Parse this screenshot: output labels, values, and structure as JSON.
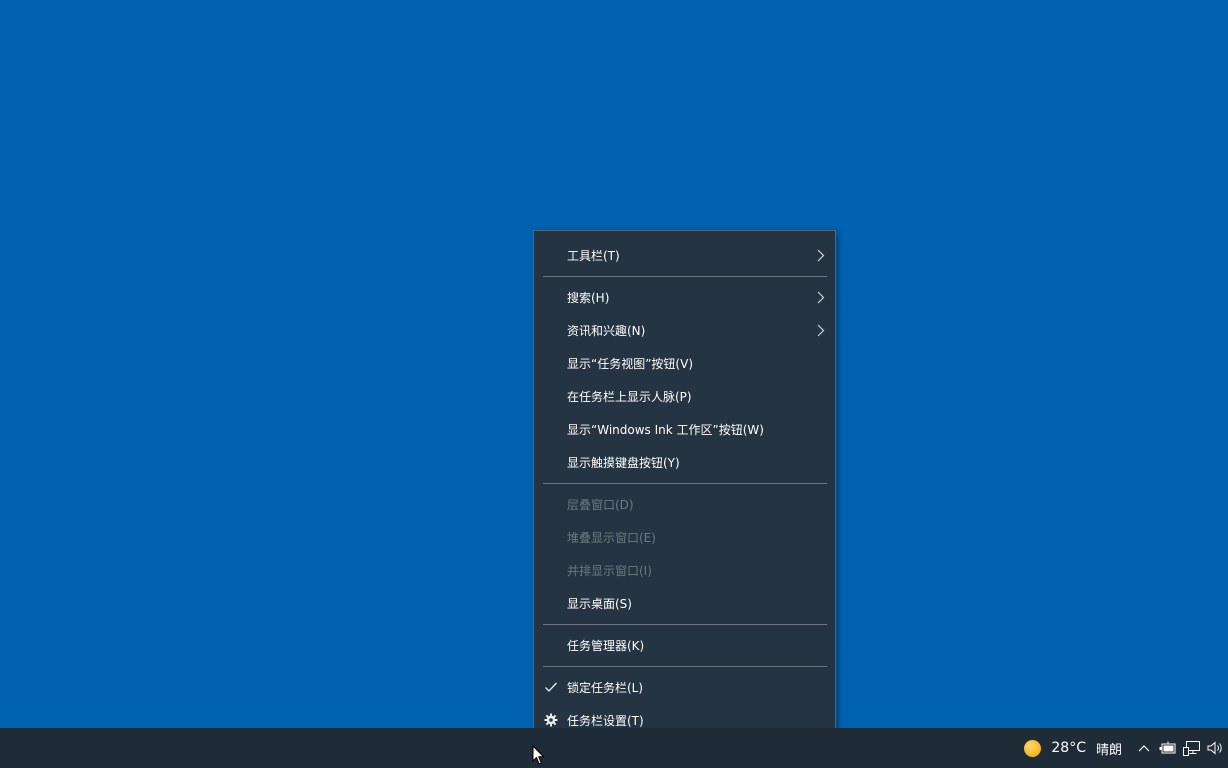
{
  "context_menu": {
    "items": [
      {
        "label": "工具栏(T)",
        "submenu": true,
        "enabled": true
      },
      {
        "label": "搜索(H)",
        "submenu": true,
        "enabled": true
      },
      {
        "label": "资讯和兴趣(N)",
        "submenu": true,
        "enabled": true
      },
      {
        "label": "显示“任务视图”按钮(V)",
        "enabled": true
      },
      {
        "label": "在任务栏上显示人脉(P)",
        "enabled": true
      },
      {
        "label": "显示“Windows Ink 工作区”按钮(W)",
        "enabled": true
      },
      {
        "label": "显示触摸键盘按钮(Y)",
        "enabled": true
      },
      {
        "label": "层叠窗口(D)",
        "enabled": false
      },
      {
        "label": "堆叠显示窗口(E)",
        "enabled": false
      },
      {
        "label": "并排显示窗口(I)",
        "enabled": false
      },
      {
        "label": "显示桌面(S)",
        "enabled": true
      },
      {
        "label": "任务管理器(K)",
        "enabled": true
      },
      {
        "label": "锁定任务栏(L)",
        "checked": true,
        "enabled": true
      },
      {
        "label": "任务栏设置(T)",
        "icon": "gear-icon",
        "enabled": true
      }
    ]
  },
  "taskbar": {
    "weather": {
      "temperature": "28°C",
      "condition": "晴朗",
      "icon": "sun-icon"
    },
    "tray_icons": [
      "chevron-up-icon",
      "battery-icon",
      "network-icon",
      "volume-icon"
    ]
  },
  "colors": {
    "desktop": "#0062b1",
    "taskbar": "#1f2b36",
    "menu_bg": "#243442",
    "menu_disabled_text": "#6d7882"
  }
}
